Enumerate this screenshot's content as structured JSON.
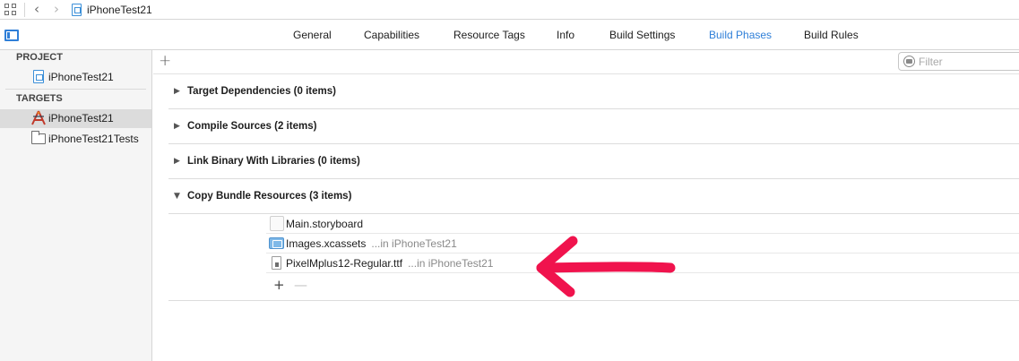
{
  "jumpbar": {
    "title": "iPhoneTest21"
  },
  "tabs": [
    {
      "label": "General",
      "active": false
    },
    {
      "label": "Capabilities",
      "active": false
    },
    {
      "label": "Resource Tags",
      "active": false
    },
    {
      "label": "Info",
      "active": false
    },
    {
      "label": "Build Settings",
      "active": false
    },
    {
      "label": "Build Phases",
      "active": true
    },
    {
      "label": "Build Rules",
      "active": false
    }
  ],
  "sidebar": {
    "project_header": "PROJECT",
    "project_item": "iPhoneTest21",
    "targets_header": "TARGETS",
    "targets": [
      {
        "label": "iPhoneTest21",
        "selected": true,
        "icon": "app-target-icon"
      },
      {
        "label": "iPhoneTest21Tests",
        "selected": false,
        "icon": "test-bundle-icon"
      }
    ]
  },
  "toolbar": {
    "add_label": "+",
    "filter_placeholder": "Filter"
  },
  "phases": [
    {
      "title": "Target Dependencies (0 items)",
      "expanded": false
    },
    {
      "title": "Compile Sources (2 items)",
      "expanded": false
    },
    {
      "title": "Link Binary With Libraries (0 items)",
      "expanded": false
    },
    {
      "title": "Copy Bundle Resources (3 items)",
      "expanded": true
    }
  ],
  "copy_resources": {
    "files": [
      {
        "name": "Main.storyboard",
        "location": "",
        "icon": "storyboard-icon"
      },
      {
        "name": "Images.xcassets",
        "location": "...in iPhoneTest21",
        "icon": "xcassets-icon"
      },
      {
        "name": "PixelMplus12-Regular.ttf",
        "location": "...in iPhoneTest21",
        "icon": "font-file-icon"
      }
    ],
    "add_label": "+",
    "remove_label": "—"
  },
  "colors": {
    "accent": "#2f7fd8",
    "annotation_arrow": "#f0134d",
    "sidebar_bg": "#f5f5f5",
    "selected_row": "#dcdcdc"
  }
}
